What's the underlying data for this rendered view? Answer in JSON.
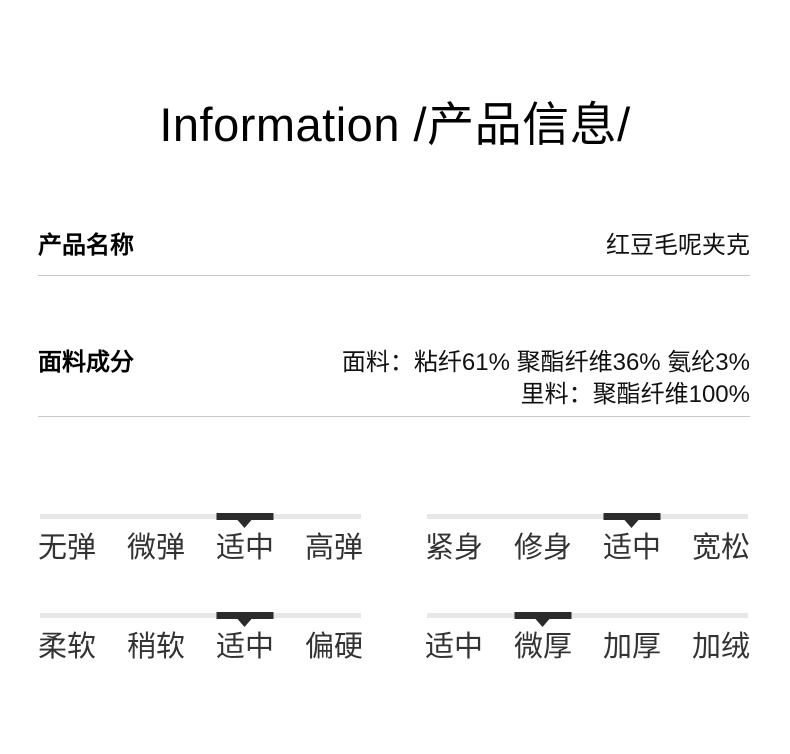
{
  "header": {
    "title": "Information /产品信息/"
  },
  "product": {
    "name_label": "产品名称",
    "name_value": "红豆毛呢夹克",
    "fabric_label": "面料成分",
    "fabric_shell": "面料：粘纤61% 聚酯纤维36% 氨纶3%",
    "fabric_lining": "里料：聚酯纤维100%"
  },
  "scales": [
    {
      "options": [
        "无弹",
        "微弹",
        "适中",
        "高弹"
      ],
      "selected_index": 2
    },
    {
      "options": [
        "紧身",
        "修身",
        "适中",
        "宽松"
      ],
      "selected_index": 2
    },
    {
      "options": [
        "柔软",
        "稍软",
        "适中",
        "偏硬"
      ],
      "selected_index": 2
    },
    {
      "options": [
        "适中",
        "微厚",
        "加厚",
        "加绒"
      ],
      "selected_index": 1
    }
  ],
  "colors": {
    "text-strong": "#000000",
    "text": "#111111",
    "text-scale": "#333333",
    "divider": "#c9c9c9",
    "track": "#e7e7e7",
    "marker": "#2b2b2b"
  }
}
